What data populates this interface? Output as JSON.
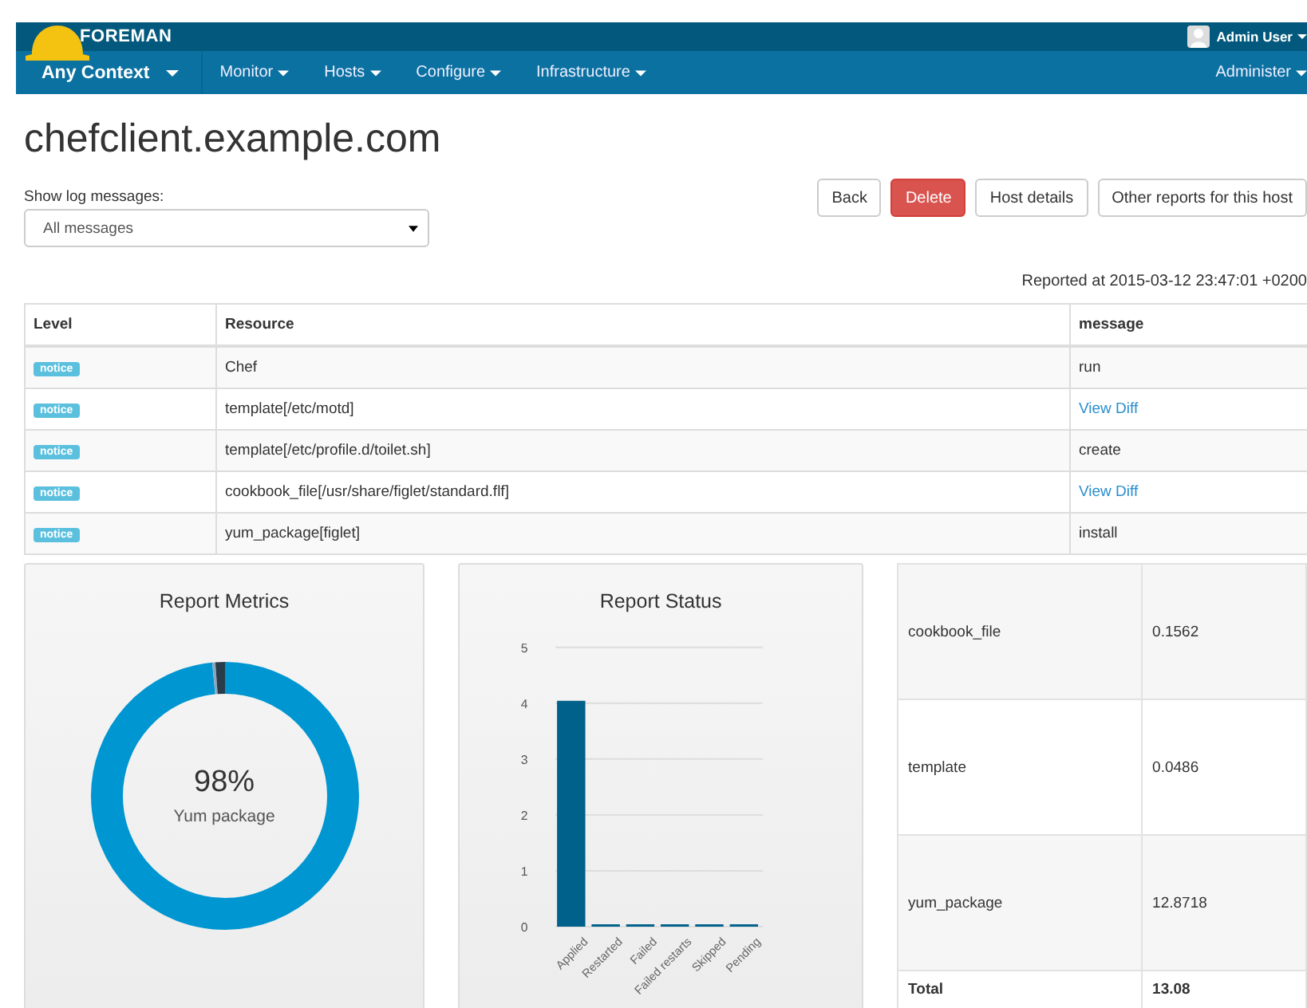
{
  "navbar": {
    "brand": "FOREMAN",
    "user": "Admin User",
    "context": "Any Context",
    "menus": [
      "Monitor",
      "Hosts",
      "Configure",
      "Infrastructure"
    ],
    "right_menu": "Administer"
  },
  "title": "chefclient.example.com",
  "log_filter": {
    "label": "Show log messages:",
    "value": "All messages"
  },
  "buttons": [
    {
      "label": "Back",
      "kind": "default"
    },
    {
      "label": "Delete",
      "kind": "danger"
    },
    {
      "label": "Host details",
      "kind": "default"
    },
    {
      "label": "Other reports for this host",
      "kind": "default"
    }
  ],
  "reported_at": "Reported at 2015-03-12 23:47:01 +0200",
  "log_table": {
    "columns": [
      "Level",
      "Resource",
      "message"
    ],
    "rows": [
      {
        "level": "notice",
        "resource": "Chef",
        "message": "run",
        "link": false
      },
      {
        "level": "notice",
        "resource": "template[/etc/motd]",
        "message": "View Diff",
        "link": true
      },
      {
        "level": "notice",
        "resource": "template[/etc/profile.d/toilet.sh]",
        "message": "create",
        "link": false
      },
      {
        "level": "notice",
        "resource": "cookbook_file[/usr/share/figlet/standard.flf]",
        "message": "View Diff",
        "link": true
      },
      {
        "level": "notice",
        "resource": "yum_package[figlet]",
        "message": "install",
        "link": false
      }
    ]
  },
  "metrics_panel": {
    "title": "Report Metrics",
    "center_value": "98%",
    "center_label": "Yum package"
  },
  "status_panel": {
    "title": "Report Status",
    "chart_data": {
      "type": "bar",
      "categories": [
        "Applied",
        "Restarted",
        "Failed",
        "Failed restarts",
        "Skipped",
        "Pending"
      ],
      "values": [
        4,
        0,
        0,
        0,
        0,
        0
      ],
      "ylim": [
        0,
        5
      ],
      "grid": true,
      "yticks": [
        0,
        1,
        2,
        3,
        4,
        5
      ]
    }
  },
  "metrics_table": {
    "rows": [
      {
        "name": "cookbook_file",
        "value": "0.1562"
      },
      {
        "name": "template",
        "value": "0.0486"
      },
      {
        "name": "yum_package",
        "value": "12.8718"
      }
    ],
    "total_label": "Total",
    "total_value": "13.08"
  }
}
